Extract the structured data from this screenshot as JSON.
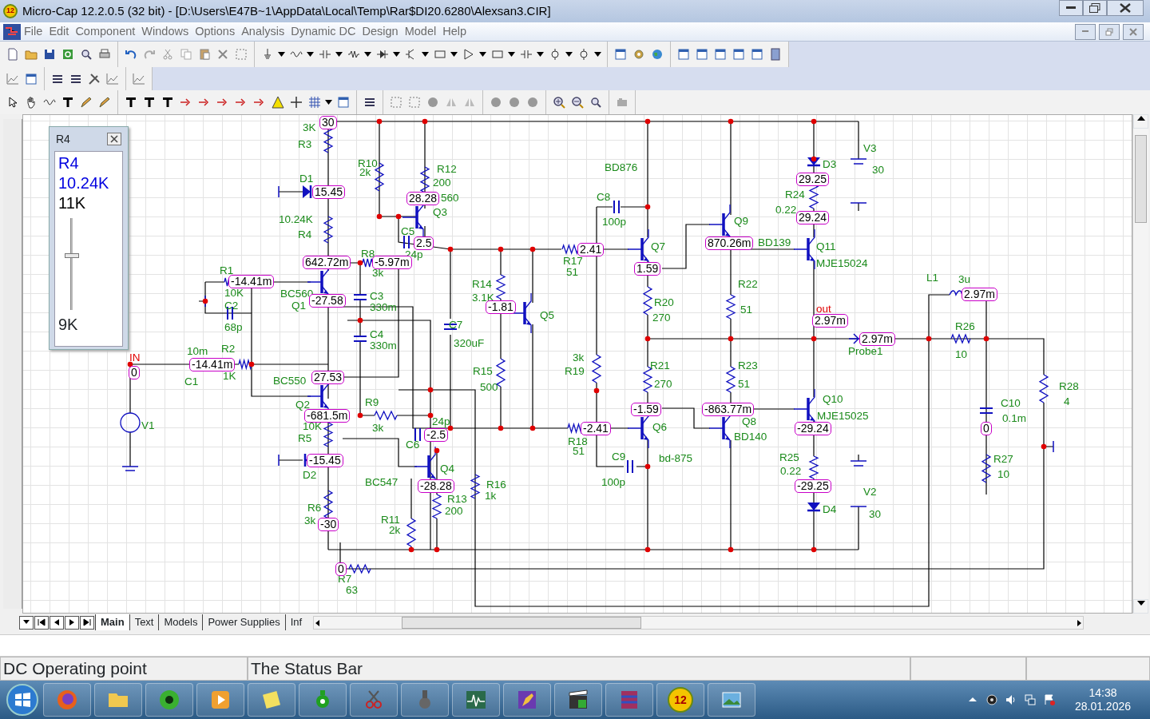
{
  "window": {
    "title": "Micro-Cap 12.2.0.5 (32 bit) - [D:\\Users\\E47B~1\\AppData\\Local\\Temp\\Rar$DI20.6280\\Alexsan3.CIR]",
    "app_badge": "12"
  },
  "menu": [
    "File",
    "Edit",
    "Component",
    "Windows",
    "Options",
    "Analysis",
    "Dynamic DC",
    "Design",
    "Model",
    "Help"
  ],
  "slider_panel": {
    "title": "R4",
    "part": "R4",
    "value": "10.24K",
    "max": "11K",
    "min": "9K",
    "level": 0.6
  },
  "schematic": {
    "labels": [
      {
        "text": "3K",
        "kind": "label"
      },
      {
        "text": "R3",
        "kind": "label"
      },
      {
        "text": "D1",
        "kind": "label"
      },
      {
        "text": "10.24K",
        "kind": "label"
      },
      {
        "text": "R4",
        "kind": "label"
      },
      {
        "text": "R10",
        "kind": "label"
      },
      {
        "text": "2k",
        "kind": "label"
      },
      {
        "text": "R12",
        "kind": "label"
      },
      {
        "text": "200",
        "kind": "label"
      },
      {
        "text": "560",
        "kind": "label"
      },
      {
        "text": "Q3",
        "kind": "label"
      },
      {
        "text": "C5",
        "kind": "label"
      },
      {
        "text": "R8",
        "kind": "label"
      },
      {
        "text": "24p",
        "kind": "label"
      },
      {
        "text": "R1",
        "kind": "label"
      },
      {
        "text": "3k",
        "kind": "label"
      },
      {
        "text": "10K",
        "kind": "label"
      },
      {
        "text": "C2",
        "kind": "label"
      },
      {
        "text": "68p",
        "kind": "label"
      },
      {
        "text": "BC560",
        "kind": "label"
      },
      {
        "text": "Q1",
        "kind": "label"
      },
      {
        "text": "C3",
        "kind": "label"
      },
      {
        "text": "330m",
        "kind": "label"
      },
      {
        "text": "C4",
        "kind": "label"
      },
      {
        "text": "330m",
        "kind": "label"
      },
      {
        "text": "C7",
        "kind": "label"
      },
      {
        "text": "320uF",
        "kind": "label"
      },
      {
        "text": "R14",
        "kind": "label"
      },
      {
        "text": "3.1K",
        "kind": "label"
      },
      {
        "text": "Q5",
        "kind": "label"
      },
      {
        "text": "R15",
        "kind": "label"
      },
      {
        "text": "500",
        "kind": "label"
      },
      {
        "text": "10m",
        "kind": "label"
      },
      {
        "text": "R2",
        "kind": "label"
      },
      {
        "text": "1K",
        "kind": "label"
      },
      {
        "text": "C1",
        "kind": "label"
      },
      {
        "text": "BC550",
        "kind": "label"
      },
      {
        "text": "Q2",
        "kind": "label"
      },
      {
        "text": "10K",
        "kind": "label"
      },
      {
        "text": "R5",
        "kind": "label"
      },
      {
        "text": "R9",
        "kind": "label"
      },
      {
        "text": "3k",
        "kind": "label"
      },
      {
        "text": "24p",
        "kind": "label"
      },
      {
        "text": "C6",
        "kind": "label"
      },
      {
        "text": "D2",
        "kind": "label"
      },
      {
        "text": "BC547",
        "kind": "label"
      },
      {
        "text": "Q4",
        "kind": "label"
      },
      {
        "text": "R13",
        "kind": "label"
      },
      {
        "text": "200",
        "kind": "label"
      },
      {
        "text": "R16",
        "kind": "label"
      },
      {
        "text": "1k",
        "kind": "label"
      },
      {
        "text": "R11",
        "kind": "label"
      },
      {
        "text": "2k",
        "kind": "label"
      },
      {
        "text": "R6",
        "kind": "label"
      },
      {
        "text": "3k",
        "kind": "label"
      },
      {
        "text": "R7",
        "kind": "label"
      },
      {
        "text": "63",
        "kind": "label"
      },
      {
        "text": "V1",
        "kind": "label"
      },
      {
        "text": "BD876",
        "kind": "label"
      },
      {
        "text": "C8",
        "kind": "label"
      },
      {
        "text": "100p",
        "kind": "label"
      },
      {
        "text": "Q7",
        "kind": "label"
      },
      {
        "text": "R17",
        "kind": "label"
      },
      {
        "text": "51",
        "kind": "label"
      },
      {
        "text": "Q9",
        "kind": "label"
      },
      {
        "text": "BD139",
        "kind": "label"
      },
      {
        "text": "Q11",
        "kind": "label"
      },
      {
        "text": "MJE15024",
        "kind": "label"
      },
      {
        "text": "R22",
        "kind": "label"
      },
      {
        "text": "51",
        "kind": "label"
      },
      {
        "text": "R20",
        "kind": "label"
      },
      {
        "text": "270",
        "kind": "label"
      },
      {
        "text": "3k",
        "kind": "label"
      },
      {
        "text": "R19",
        "kind": "label"
      },
      {
        "text": "R21",
        "kind": "label"
      },
      {
        "text": "270",
        "kind": "label"
      },
      {
        "text": "R23",
        "kind": "label"
      },
      {
        "text": "51",
        "kind": "label"
      },
      {
        "text": "Q6",
        "kind": "label"
      },
      {
        "text": "R18",
        "kind": "label"
      },
      {
        "text": "51",
        "kind": "label"
      },
      {
        "text": "C9",
        "kind": "label"
      },
      {
        "text": "100p",
        "kind": "label"
      },
      {
        "text": "bd-875",
        "kind": "label"
      },
      {
        "text": "Q8",
        "kind": "label"
      },
      {
        "text": "BD140",
        "kind": "label"
      },
      {
        "text": "Q10",
        "kind": "label"
      },
      {
        "text": "MJE15025",
        "kind": "label"
      },
      {
        "text": "R25",
        "kind": "label"
      },
      {
        "text": "0.22",
        "kind": "label"
      },
      {
        "text": "D3",
        "kind": "label"
      },
      {
        "text": "R24",
        "kind": "label"
      },
      {
        "text": "0.22",
        "kind": "label"
      },
      {
        "text": "V3",
        "kind": "label"
      },
      {
        "text": "30",
        "kind": "label"
      },
      {
        "text": "V2",
        "kind": "label"
      },
      {
        "text": "30",
        "kind": "label"
      },
      {
        "text": "D4",
        "kind": "label"
      },
      {
        "text": "L1",
        "kind": "label"
      },
      {
        "text": "3u",
        "kind": "label"
      },
      {
        "text": "R26",
        "kind": "label"
      },
      {
        "text": "10",
        "kind": "label"
      },
      {
        "text": "Probe1",
        "kind": "label"
      },
      {
        "text": "R28",
        "kind": "label"
      },
      {
        "text": "C10",
        "kind": "label"
      },
      {
        "text": "4",
        "kind": "label"
      },
      {
        "text": "0.1m",
        "kind": "label"
      },
      {
        "text": "R27",
        "kind": "label"
      },
      {
        "text": "10",
        "kind": "label"
      },
      {
        "text": "IN",
        "kind": "net"
      },
      {
        "text": "out",
        "kind": "net"
      },
      {
        "text": "30",
        "kind": "node"
      },
      {
        "text": "15.45",
        "kind": "node"
      },
      {
        "text": "28.28",
        "kind": "node"
      },
      {
        "text": "2.5",
        "kind": "node"
      },
      {
        "text": "642.72m",
        "kind": "node"
      },
      {
        "text": "-5.97m",
        "kind": "node"
      },
      {
        "text": "-14.41m",
        "kind": "node"
      },
      {
        "text": "-27.58",
        "kind": "node"
      },
      {
        "text": "-1.81",
        "kind": "node"
      },
      {
        "text": "0",
        "kind": "node"
      },
      {
        "text": "-14.41m",
        "kind": "node"
      },
      {
        "text": "27.53",
        "kind": "node"
      },
      {
        "text": "-681.5m",
        "kind": "node"
      },
      {
        "text": "-2.5",
        "kind": "node"
      },
      {
        "text": "-15.45",
        "kind": "node"
      },
      {
        "text": "-28.28",
        "kind": "node"
      },
      {
        "text": "-30",
        "kind": "node"
      },
      {
        "text": "0",
        "kind": "node"
      },
      {
        "text": "2.41",
        "kind": "node"
      },
      {
        "text": "1.59",
        "kind": "node"
      },
      {
        "text": "870.26m",
        "kind": "node"
      },
      {
        "text": "29.25",
        "kind": "node"
      },
      {
        "text": "29.24",
        "kind": "node"
      },
      {
        "text": "2.97m",
        "kind": "node"
      },
      {
        "text": "2.97m",
        "kind": "node"
      },
      {
        "text": "2.97m",
        "kind": "node"
      },
      {
        "text": "-1.59",
        "kind": "node"
      },
      {
        "text": "-2.41",
        "kind": "node"
      },
      {
        "text": "-863.77m",
        "kind": "node"
      },
      {
        "text": "-29.24",
        "kind": "node"
      },
      {
        "text": "-29.25",
        "kind": "node"
      },
      {
        "text": "0",
        "kind": "node"
      }
    ]
  },
  "sheet_tabs": [
    {
      "label": "Main",
      "selected": true
    },
    {
      "label": "Text",
      "selected": false
    },
    {
      "label": "Models",
      "selected": false
    },
    {
      "label": "Power Supplies",
      "selected": false
    },
    {
      "label": "Inf",
      "selected": false
    }
  ],
  "status_bar": [
    "DC Operating point",
    "The Status Bar"
  ],
  "taskbar": {
    "app_badge": "12",
    "time": "14:38",
    "date": "28.01.2026"
  }
}
